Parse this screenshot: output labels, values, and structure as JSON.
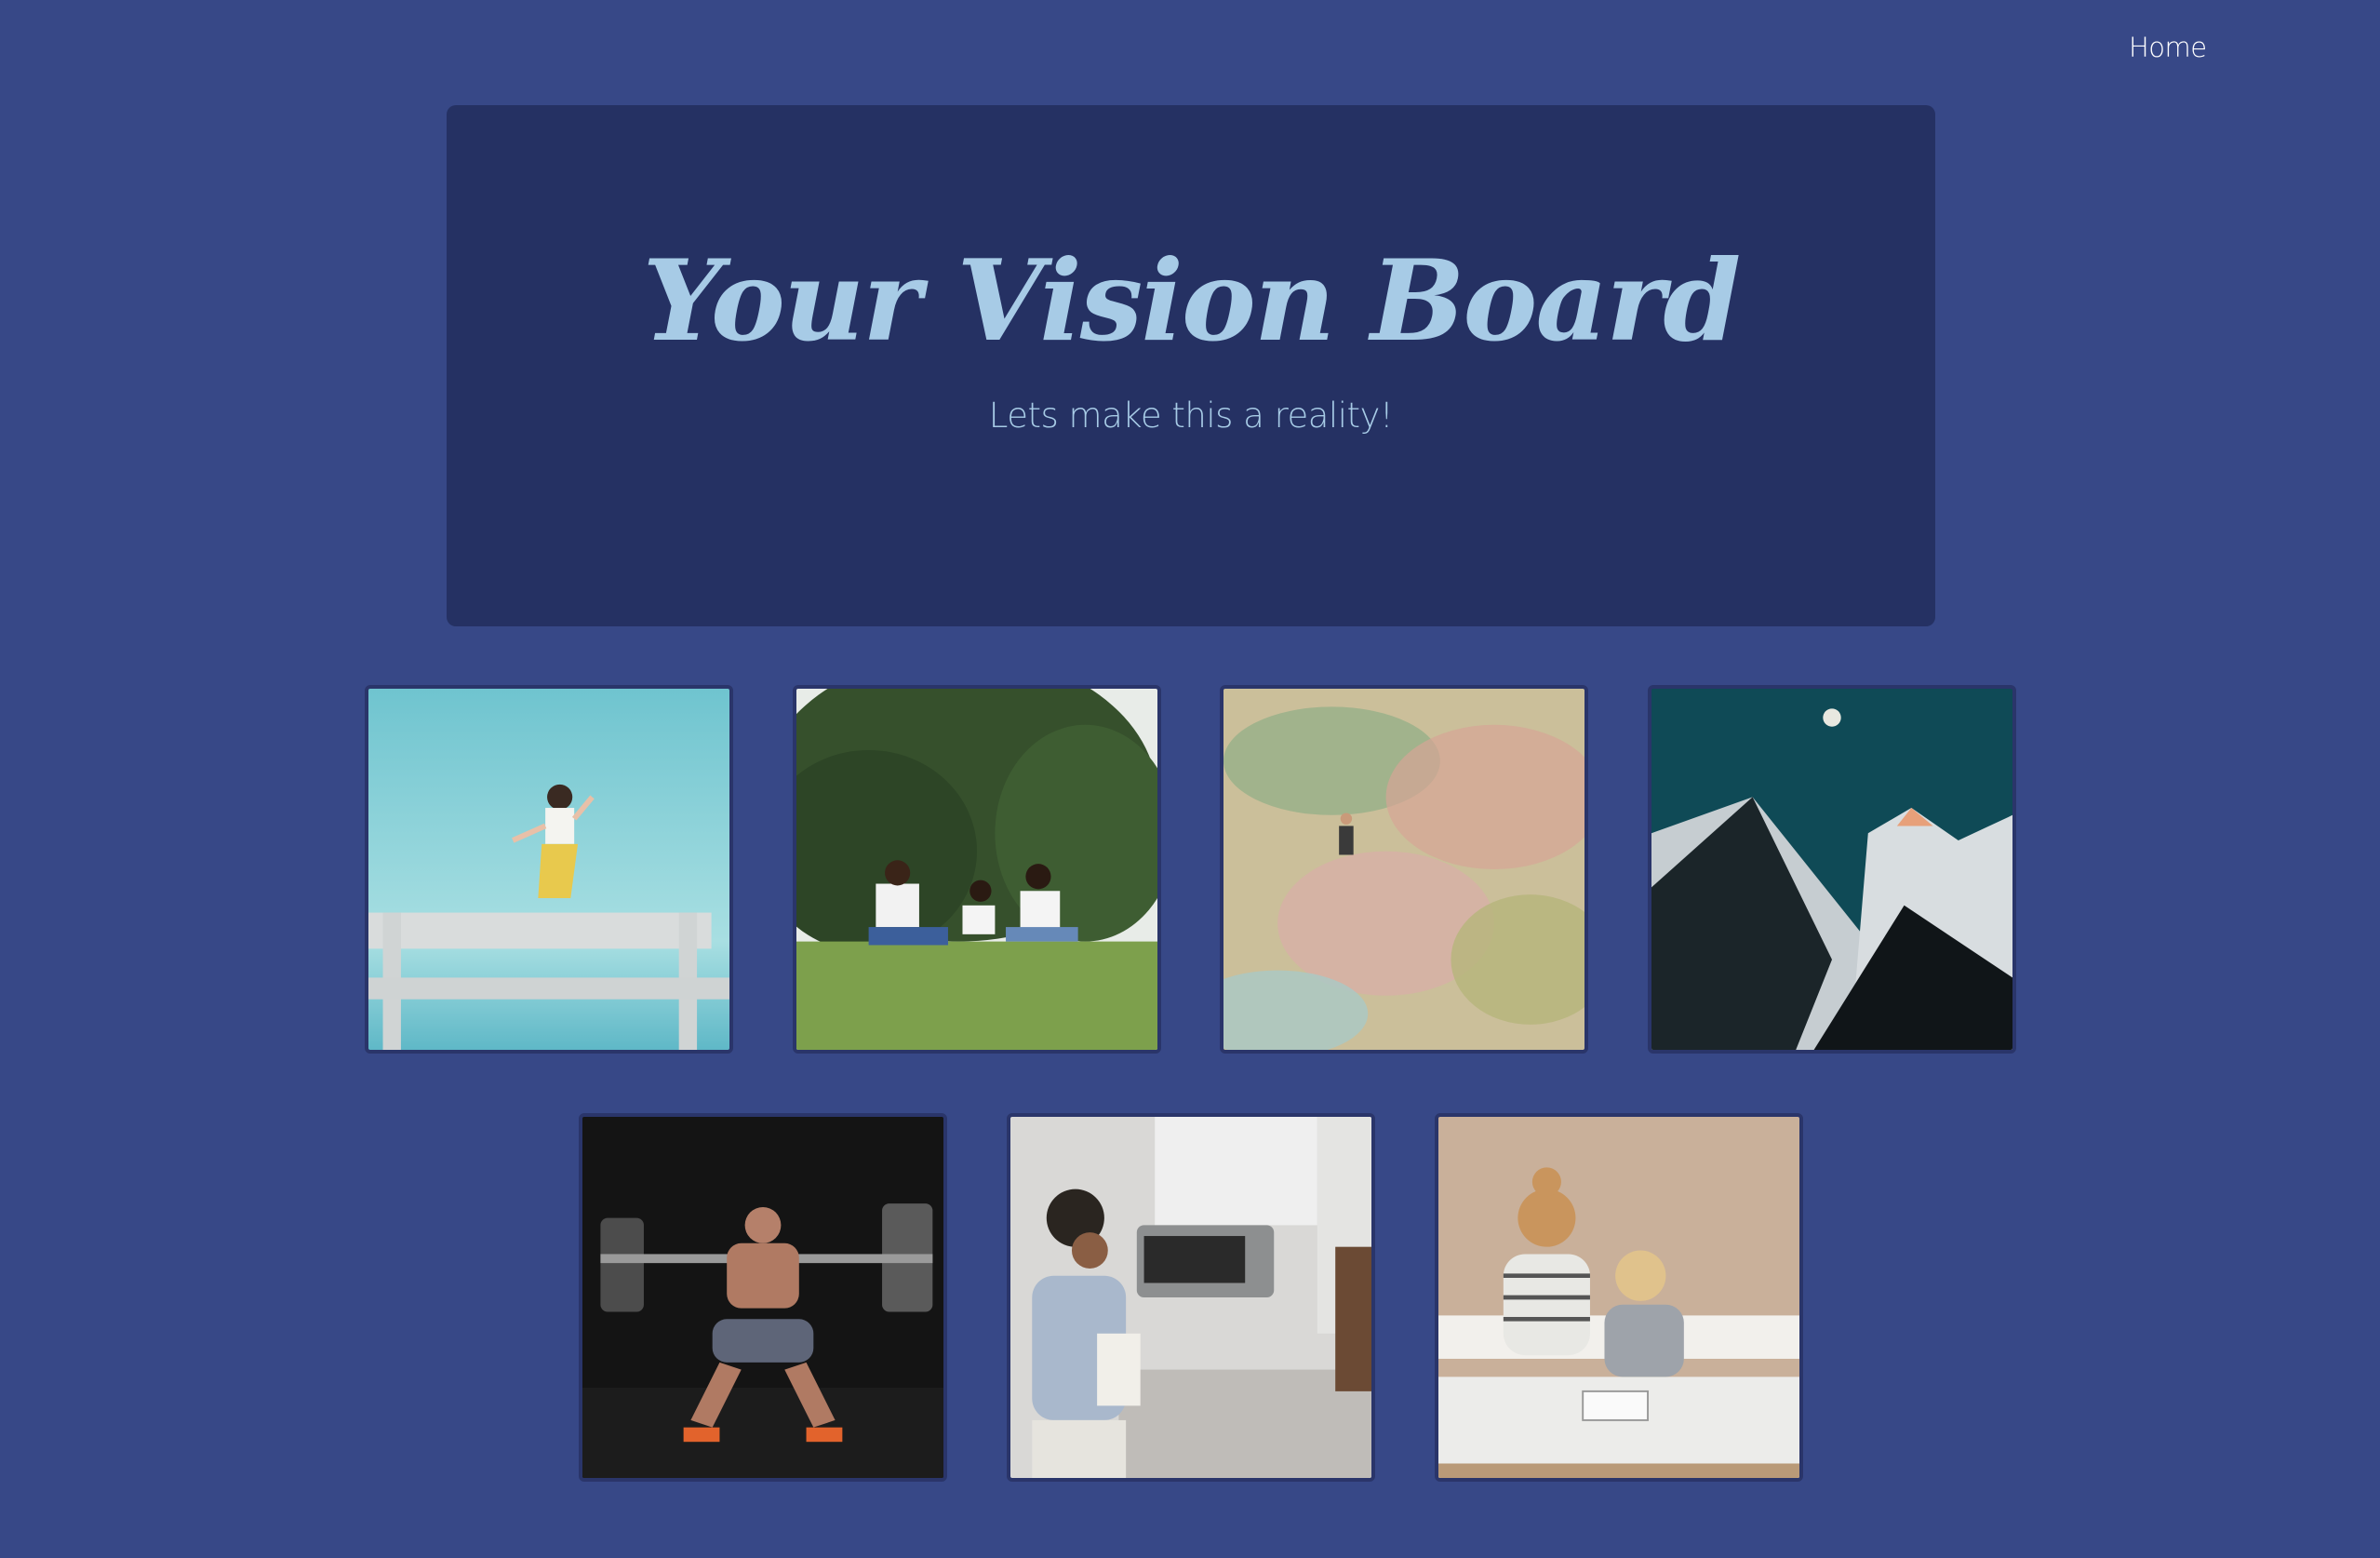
{
  "nav": {
    "home_label": "Home"
  },
  "hero": {
    "title": "Your Vision Board",
    "subtitle": "Lets make this a reality!"
  },
  "colors": {
    "background": "#374887",
    "hero_panel": "#253163",
    "accent_text": "#a7cbe6"
  },
  "gallery": {
    "row1": [
      {
        "name": "photo-girl-jumping"
      },
      {
        "name": "photo-family-in-park"
      },
      {
        "name": "photo-travel-map"
      },
      {
        "name": "photo-mountain-peaks"
      }
    ],
    "row2": [
      {
        "name": "photo-weightlifter-squat"
      },
      {
        "name": "photo-kitchen-scene"
      },
      {
        "name": "photo-kids-reading"
      }
    ]
  }
}
